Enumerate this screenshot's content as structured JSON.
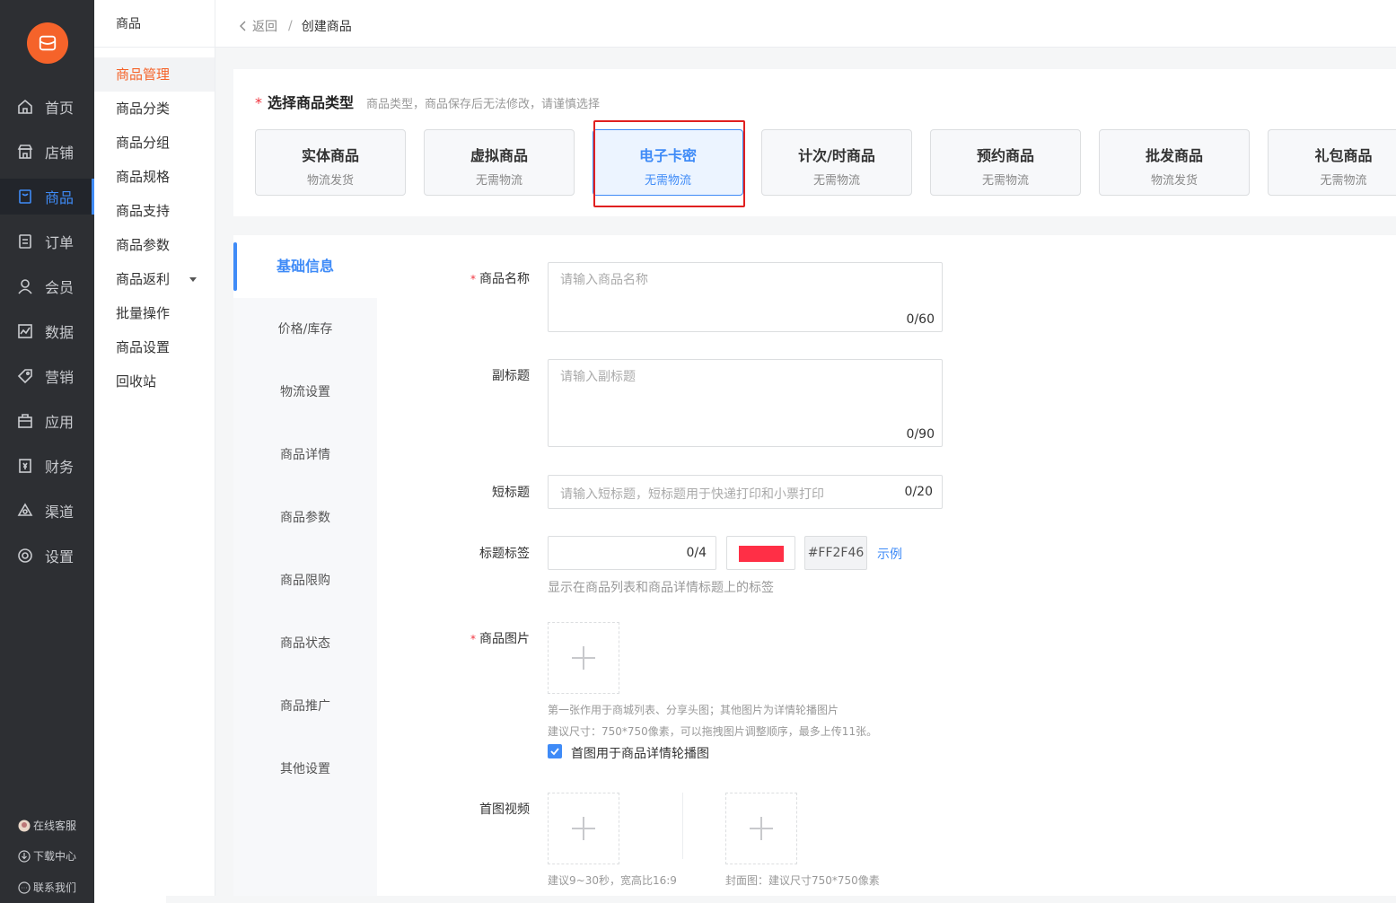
{
  "nav": {
    "items": [
      {
        "label": "首页",
        "icon": "home-icon"
      },
      {
        "label": "店铺",
        "icon": "shop-icon"
      },
      {
        "label": "商品",
        "icon": "goods-icon",
        "active": true
      },
      {
        "label": "订单",
        "icon": "order-icon"
      },
      {
        "label": "会员",
        "icon": "user-icon"
      },
      {
        "label": "数据",
        "icon": "chart-icon"
      },
      {
        "label": "营销",
        "icon": "tag-icon"
      },
      {
        "label": "应用",
        "icon": "app-icon"
      },
      {
        "label": "财务",
        "icon": "finance-icon"
      },
      {
        "label": "渠道",
        "icon": "channel-icon"
      },
      {
        "label": "设置",
        "icon": "gear-icon"
      }
    ],
    "footer": [
      {
        "label": "在线客服",
        "icon": "service-avatar-icon"
      },
      {
        "label": "下载中心",
        "icon": "download-icon"
      },
      {
        "label": "联系我们",
        "icon": "chat-icon"
      }
    ]
  },
  "submenu": {
    "title": "商品",
    "items": [
      "商品管理",
      "商品分类",
      "商品分组",
      "商品规格",
      "商品支持",
      "商品参数",
      "商品返利",
      "批量操作",
      "商品设置",
      "回收站"
    ],
    "active_index": 0
  },
  "breadcrumb": {
    "back": "返回",
    "separator": "/",
    "current": "创建商品"
  },
  "goods_type": {
    "required_mark": "*",
    "title": "选择商品类型",
    "tip": "商品类型，商品保存后无法修改，请谨慎选择",
    "options": [
      {
        "title": "实体商品",
        "sub": "物流发货"
      },
      {
        "title": "虚拟商品",
        "sub": "无需物流"
      },
      {
        "title": "电子卡密",
        "sub": "无需物流",
        "selected": true
      },
      {
        "title": "计次/时商品",
        "sub": "无需物流"
      },
      {
        "title": "预约商品",
        "sub": "无需物流"
      },
      {
        "title": "批发商品",
        "sub": "物流发货"
      },
      {
        "title": "礼包商品",
        "sub": "无需物流"
      }
    ]
  },
  "tabs": [
    "基础信息",
    "价格/库存",
    "物流设置",
    "商品详情",
    "商品参数",
    "商品限购",
    "商品状态",
    "商品推广",
    "其他设置"
  ],
  "form": {
    "name": {
      "label": "商品名称",
      "required": "*",
      "placeholder": "请输入商品名称",
      "counter": "0/60"
    },
    "subtitle": {
      "label": "副标题",
      "placeholder": "请输入副标题",
      "counter": "0/90"
    },
    "short_title": {
      "label": "短标题",
      "placeholder": "请输入短标题，短标题用于快递打印和小票打印",
      "counter": "0/20"
    },
    "title_tag": {
      "label": "标题标签",
      "counter": "0/4",
      "color": "#FF2F46",
      "example": "示例",
      "hint": "显示在商品列表和商品详情标题上的标签"
    },
    "images": {
      "label": "商品图片",
      "required": "*",
      "hint1": "第一张作用于商城列表、分享头图；其他图片为详情轮播图片",
      "hint2": "建议尺寸：750*750像素，可以拖拽图片调整顺序，最多上传11张。",
      "checkbox_label": "首图用于商品详情轮播图"
    },
    "video": {
      "label": "首图视频",
      "video_hint": "建议9~30秒，宽高比16:9",
      "cover_hint": "封面图：建议尺寸750*750像素"
    }
  }
}
